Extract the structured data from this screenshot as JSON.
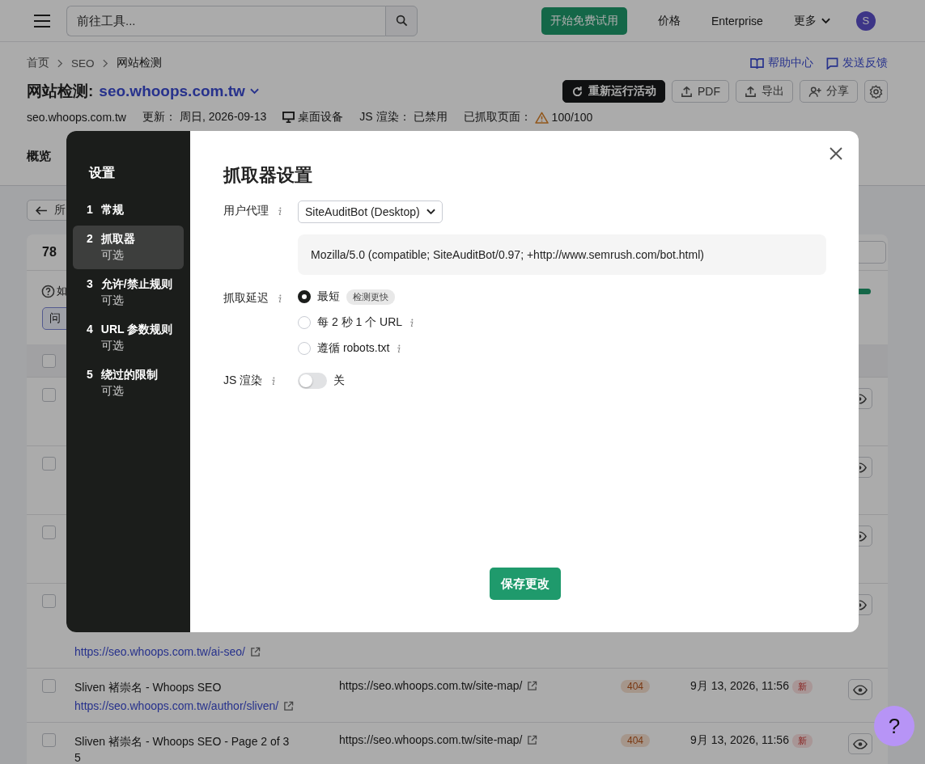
{
  "topbar": {
    "search": {
      "placeholder": "前往工具..."
    },
    "trial_button": "开始免费试用",
    "links": [
      "价格",
      "Enterprise"
    ],
    "more": "更多",
    "avatar": "S"
  },
  "breadcrumb": [
    "首页",
    "SEO",
    "网站检测"
  ],
  "help_links": [
    {
      "kind": "help",
      "label": "帮助中心"
    },
    {
      "kind": "feedback",
      "label": "发送反馈"
    }
  ],
  "title": {
    "label": "网站检测:",
    "project": "seo.whoops.com.tw"
  },
  "actions": [
    {
      "kind": "rerun",
      "label": "重新运行活动"
    },
    {
      "kind": "upload",
      "label": "PDF"
    },
    {
      "kind": "upload",
      "label": "导出"
    },
    {
      "kind": "share",
      "label": "分享"
    },
    {
      "kind": "settings"
    }
  ],
  "meta": [
    {
      "kind": "text",
      "value": "seo.whoops.com.tw"
    },
    {
      "kind": "pair",
      "label": "更新：",
      "value": "周日, 2026-09-13"
    },
    {
      "kind": "device",
      "value": "桌面设备"
    },
    {
      "kind": "pair",
      "label": "JS 渲染：",
      "value": "已禁用"
    },
    {
      "kind": "warning",
      "label": "已抓取页面：",
      "value": "100/100"
    }
  ],
  "tabs": [
    "概览"
  ],
  "back_button": "所",
  "card": {
    "count": "78",
    "hint": "如",
    "progress": {
      "level": 1
    },
    "filter": "问",
    "select_all": {
      "checked": false
    },
    "rows": [
      {
        "checked": false
      },
      {
        "checked": false
      },
      {
        "checked": false
      },
      {
        "checked": false,
        "link": "https://seo.whoops.com.tw/ai-seo/"
      },
      {
        "checked": false,
        "title": "Sliven 褚崇名 - Whoops SEO",
        "link": "https://seo.whoops.com.tw/author/sliven/",
        "target": "https://seo.whoops.com.tw/site-map/",
        "code": "404",
        "date": "9月 13, 2026, 11:56",
        "badge": "新"
      },
      {
        "checked": false,
        "title": "Sliven 褚崇名 - Whoops SEO - Page 2 of 3 5",
        "target": "https://seo.whoops.com.tw/site-map/",
        "code": "404",
        "date": "9月 13, 2026, 11:56",
        "badge": "新"
      }
    ]
  },
  "modal": {
    "sidebar_title": "设置",
    "steps": [
      {
        "number": "1",
        "label": "常规",
        "selected": false
      },
      {
        "number": "2",
        "label": "抓取器",
        "sublabel": "可选",
        "selected": true
      },
      {
        "number": "3",
        "label": "允许/禁止规则",
        "sublabel": "可选",
        "selected": false
      },
      {
        "number": "4",
        "label": "URL 参数规则",
        "sublabel": "可选",
        "selected": false
      },
      {
        "number": "5",
        "label": "绕过的限制",
        "sublabel": "可选",
        "selected": false
      }
    ],
    "title": "抓取器设置",
    "user_agent": {
      "label": "用户代理",
      "value": "SiteAuditBot (Desktop)",
      "string": "Mozilla/5.0 (compatible; SiteAuditBot/0.97; +http://www.semrush.com/bot.html)"
    },
    "delay": {
      "label": "抓取延迟",
      "options": [
        {
          "label": "最短",
          "tag": "检测更快",
          "info": false,
          "selected": true
        },
        {
          "label": "每 2 秒 1 个 URL",
          "info": true,
          "selected": false
        },
        {
          "label": "遵循 robots.txt",
          "info": true,
          "selected": false
        }
      ]
    },
    "js": {
      "label": "JS 渲染",
      "on": false,
      "state_label": "关"
    },
    "save_button": "保存更改"
  },
  "help_button": "?"
}
